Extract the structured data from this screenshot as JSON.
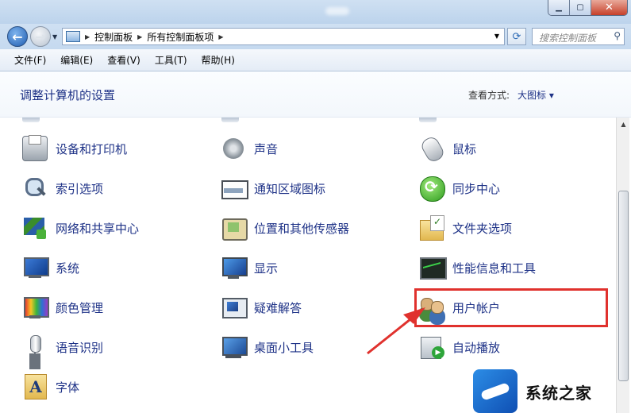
{
  "nav": {
    "breadcrumb": [
      "控制面板",
      "所有控制面板项"
    ],
    "search_placeholder": "搜索控制面板"
  },
  "menu": [
    "文件(F)",
    "编辑(E)",
    "查看(V)",
    "工具(T)",
    "帮助(H)"
  ],
  "header": {
    "title": "调整计算机的设置",
    "view_label": "查看方式:",
    "view_value": "大图标 ▾"
  },
  "items": [
    {
      "label": "设备和打印机",
      "icon": "printer-icon"
    },
    {
      "label": "声音",
      "icon": "speaker-icon"
    },
    {
      "label": "鼠标",
      "icon": "mouse-icon"
    },
    {
      "label": "索引选项",
      "icon": "magnifier-icon"
    },
    {
      "label": "通知区域图标",
      "icon": "taskbar-icon"
    },
    {
      "label": "同步中心",
      "icon": "sync-icon"
    },
    {
      "label": "网络和共享中心",
      "icon": "network-icon"
    },
    {
      "label": "位置和其他传感器",
      "icon": "sensor-icon"
    },
    {
      "label": "文件夹选项",
      "icon": "folder-icon"
    },
    {
      "label": "系统",
      "icon": "computer-icon"
    },
    {
      "label": "显示",
      "icon": "monitor-icon"
    },
    {
      "label": "性能信息和工具",
      "icon": "performance-icon"
    },
    {
      "label": "颜色管理",
      "icon": "color-icon"
    },
    {
      "label": "疑难解答",
      "icon": "troubleshoot-icon"
    },
    {
      "label": "用户帐户",
      "icon": "users-icon"
    },
    {
      "label": "语音识别",
      "icon": "microphone-icon"
    },
    {
      "label": "桌面小工具",
      "icon": "gadgets-icon"
    },
    {
      "label": "自动播放",
      "icon": "autoplay-icon"
    },
    {
      "label": "字体",
      "icon": "fonts-icon"
    }
  ],
  "watermark": {
    "text": "系统之家"
  },
  "colors": {
    "link": "#1e3287",
    "highlight": "#e0312d",
    "titlebar": "#c5d9ef"
  }
}
